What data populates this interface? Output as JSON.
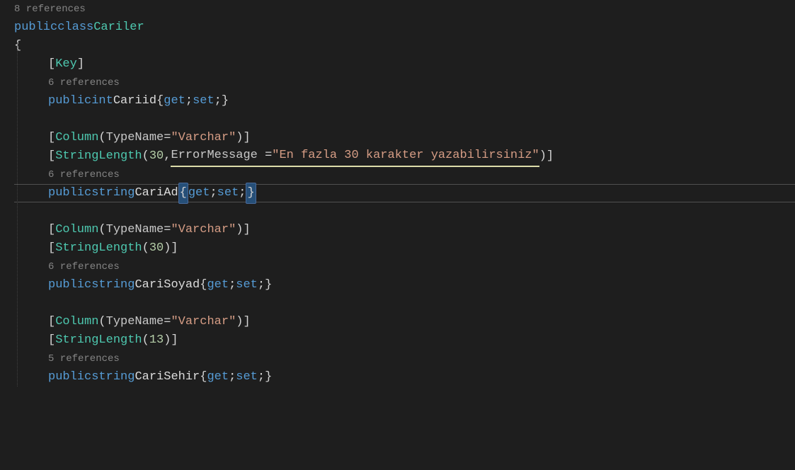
{
  "class": {
    "refs": "8 references",
    "public": "public",
    "class_kw": "class",
    "name": "Cariler"
  },
  "props": {
    "cariid": {
      "key_attr": "Key",
      "refs": "6 references",
      "public": "public",
      "type": "int",
      "name": "Cariid",
      "get": "get",
      "set": "set"
    },
    "cariad": {
      "column_attr": "Column",
      "typename_param": "TypeName",
      "varchar": "\"Varchar\"",
      "stringlength_attr": "StringLength",
      "length": "30",
      "errormsg_param": "ErrorMessage",
      "errormsg_value": "\"En fazla 30 karakter yazabilirsiniz\"",
      "refs": "6 references",
      "public": "public",
      "type": "string",
      "name": "CariAd",
      "get": "get",
      "set": "set"
    },
    "carisoyad": {
      "column_attr": "Column",
      "typename_param": "TypeName",
      "varchar": "\"Varchar\"",
      "stringlength_attr": "StringLength",
      "length": "30",
      "refs": "6 references",
      "public": "public",
      "type": "string",
      "name": "CariSoyad",
      "get": "get",
      "set": "set"
    },
    "carisehir": {
      "column_attr": "Column",
      "typename_param": "TypeName",
      "varchar": "\"Varchar\"",
      "stringlength_attr": "StringLength",
      "length": "13",
      "refs": "5 references",
      "public": "public",
      "type": "string",
      "name": "CariSehir",
      "get": "get",
      "set": "set"
    }
  }
}
